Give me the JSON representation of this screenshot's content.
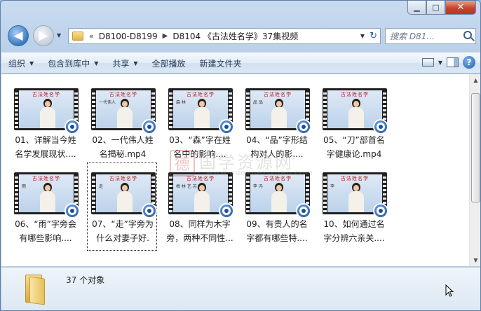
{
  "window": {
    "caption_buttons": {
      "minimize": "▁",
      "maximize": "□",
      "close": "✕"
    }
  },
  "nav": {
    "back_glyph": "◀",
    "forward_glyph": "▶",
    "address": {
      "chevron": "«",
      "crumbs": [
        "D8100-D8199",
        "D8104 《古法姓名学》37集视频"
      ],
      "separator": "▶"
    },
    "search": {
      "placeholder": "搜索 D81..."
    }
  },
  "toolbar": {
    "organize": "组织",
    "include_in_library": "包含到库中",
    "share": "共享",
    "play_all": "全部播放",
    "new_folder": "新建文件夹",
    "help": "?"
  },
  "thumb_title": "古法姓名学",
  "files": [
    {
      "name": "01、详解当今姓名学发展现状.mp4",
      "label": "01、详解当今姓名学发展现状...."
    },
    {
      "name": "02、一代伟人姓名揭秘.mp4",
      "label": "02、一代伟人姓名揭秘.mp4"
    },
    {
      "name": "03、“森”字在姓名中的影响.mp4",
      "label": "03、“森”字在姓名中的影响...."
    },
    {
      "name": "04、“品”字形结构对人的影响.mp4",
      "label": "04、“品”字形结构对人的影...."
    },
    {
      "name": "05、“刀”部首名字健康论.mp4",
      "label": "05、“刀”部首名字健康论.mp4"
    },
    {
      "name": "06、“雨”字旁会有哪些影响.mp4",
      "label": "06、“雨”字旁会有哪些影响...."
    },
    {
      "name": "07、“走”字旁为什么对妻子好.mp4",
      "label": "07、“走”字旁为什么对妻子好."
    },
    {
      "name": "08、同样为木字旁，两种不同性.mp4",
      "label": "08、同样为木字旁，两种不同性..."
    },
    {
      "name": "09、有贵人的名字都有哪些特.mp4",
      "label": "09、有贵人的名字都有哪些特...."
    },
    {
      "name": "10、如何通过名字分辨六亲关.mp4",
      "label": "10、如何通过名字分辨六亲关...."
    }
  ],
  "watermark": {
    "seal": "德",
    "text": "国学资源网",
    "url": "www.guoxueziyuan.com"
  },
  "status": {
    "item_count": "37 个对象"
  },
  "colors": {
    "accent": "#1e395b",
    "selection": "#cce8ff",
    "close": "#c7442b"
  }
}
